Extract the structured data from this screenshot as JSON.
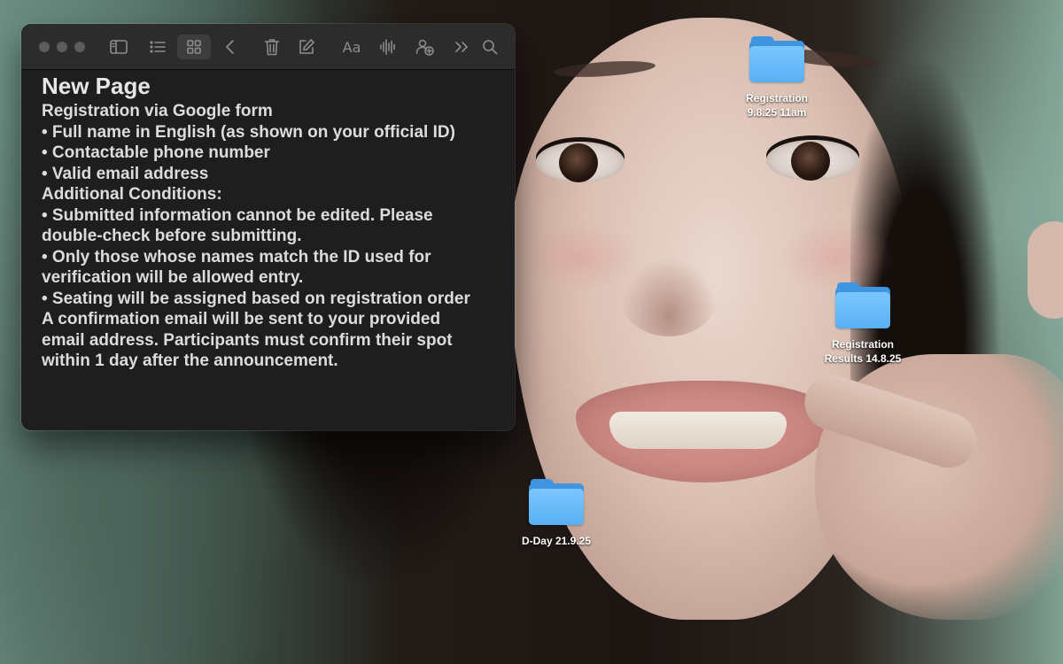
{
  "wallpaper": {
    "description_icon": "photo-wallpaper"
  },
  "window": {
    "toolbar": {
      "icons": [
        "sidebar-icon",
        "list-view-icon",
        "gallery-view-icon",
        "back-chevron-icon",
        "trash-icon",
        "compose-icon",
        "text-format-icon",
        "audio-waveform-icon",
        "collaborate-icon",
        "more-chevron-icon",
        "search-icon"
      ],
      "format_label": "Aa"
    },
    "note": {
      "title": "New Page",
      "lines": [
        "Registration via Google form",
        "• Full name in English (as shown on your official ID)",
        "• Contactable phone number",
        "• Valid email address",
        "Additional Conditions:",
        "• Submitted information cannot be edited. Please",
        "double-check before submitting.",
        "• Only those whose names match the ID used for",
        "verification will be allowed entry.",
        "• Seating will be assigned based on registration order",
        "A confirmation email will be sent to your provided",
        "email address. Participants must confirm their spot",
        "within 1 day after the announcement."
      ]
    }
  },
  "desktop": {
    "folders": [
      {
        "label": "Registration\n9.8.25 11am",
        "icon": "folder-icon"
      },
      {
        "label": "Registration\nResults 14.8.25",
        "icon": "folder-icon"
      },
      {
        "label": "D-Day 21.9.25",
        "icon": "folder-icon"
      }
    ]
  },
  "colors": {
    "folder_light": "#7cc6ff",
    "folder_dark": "#3f95e0",
    "window_bg": "#1e1e1e",
    "toolbar_bg": "#2c2c2c"
  }
}
